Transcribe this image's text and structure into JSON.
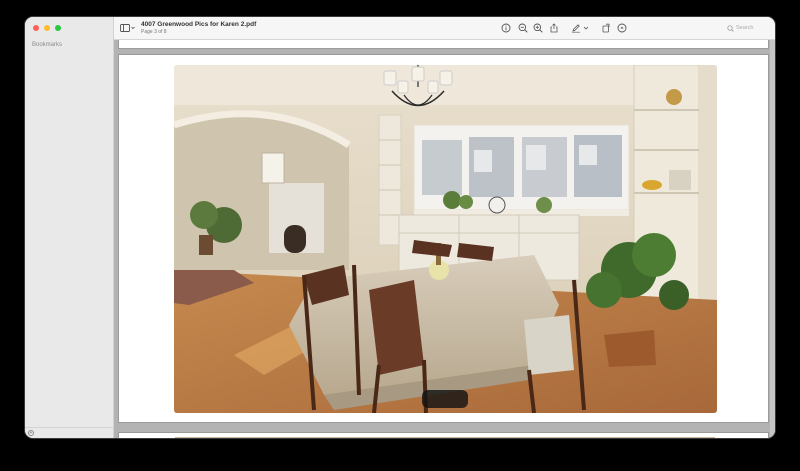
{
  "window": {
    "doc_title": "4007 Greenwood Pics for Karen 2.pdf",
    "page_indicator": "Page 3 of 8"
  },
  "sidebar": {
    "title": "Bookmarks"
  },
  "toolbar": {
    "search_placeholder": "Search",
    "icons": [
      "sidebar-toggle-icon",
      "info-icon",
      "zoom-out-icon",
      "zoom-in-icon",
      "share-icon",
      "markup-pen-icon",
      "rotate-icon",
      "annotate-icon",
      "search-icon"
    ]
  },
  "photo": {
    "subject": "dining-room-interior"
  }
}
